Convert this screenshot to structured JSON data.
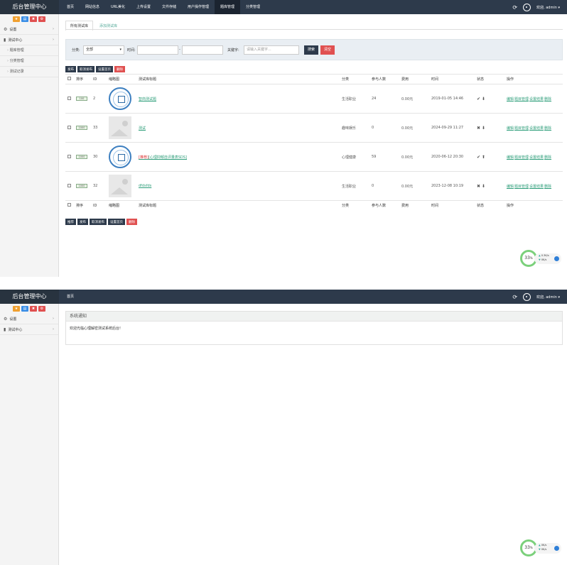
{
  "brand": "后台管理中心",
  "user": "欢迎, admin ▾",
  "top_nav": [
    "首页",
    "网站信息",
    "URL美化",
    "上传设置",
    "文件存储",
    "用户操作管理",
    "题库管理",
    "分类管理"
  ],
  "quick_buttons": [
    {
      "icon": "star-icon",
      "glyph": "★",
      "color": "#f0a030"
    },
    {
      "icon": "doc-icon",
      "glyph": "▤",
      "color": "#3a8ee6"
    },
    {
      "icon": "trash-icon",
      "glyph": "✖",
      "color": "#e05050"
    },
    {
      "icon": "gear-icon",
      "glyph": "⚙",
      "color": "#e05050"
    }
  ],
  "sidebar": {
    "settings": "设置",
    "test_center": "测试中心",
    "sub_items": [
      "题库管理",
      "分类管理",
      "测试记录"
    ]
  },
  "tabs": [
    "所有测试库",
    "添加测试库"
  ],
  "filter": {
    "category_label": "分类:",
    "category_value": "全部",
    "time_label": "时间:",
    "dash": "-",
    "keyword_label": "关键字:",
    "keyword_placeholder": "请输入关键字...",
    "search_btn": "搜索",
    "clear_btn": "清空"
  },
  "batch_top": [
    "发布",
    "取消发布",
    "设置首页",
    "删除"
  ],
  "batch_bottom": [
    "推荐",
    "发布",
    "取消发布",
    "设置首页",
    "删除"
  ],
  "columns": [
    "排序",
    "ID",
    "缩略图",
    "测试库标题",
    "分类",
    "参与人数",
    "费用",
    "时间",
    "状态",
    "操作"
  ],
  "rows": [
    {
      "order": "100",
      "id": "2",
      "thumb": "logo",
      "tag": "",
      "title": "智商测试题",
      "category": "生活职业",
      "participants": "24",
      "fee": "0.00元",
      "time": "2019-01-05 14:46",
      "status": "✔ ⬇"
    },
    {
      "order": "1000",
      "id": "33",
      "thumb": "placeholder",
      "tag": "",
      "title": "测试",
      "category": "趣味娱乐",
      "participants": "0",
      "fee": "0.00元",
      "time": "2024-09-29 11:27",
      "status": "✖ ⬇"
    },
    {
      "order": "1000",
      "id": "30",
      "thumb": "logo",
      "tag": "[推荐]",
      "title": "[心理抑郁自评量表SDS]",
      "category": "心理健康",
      "participants": "59",
      "fee": "0.00元",
      "time": "2020-06-12 20:30",
      "status": "✔ ⬆"
    },
    {
      "order": "1000",
      "id": "32",
      "thumb": "placeholder",
      "tag": "",
      "title": "dfdsfds",
      "category": "生活职业",
      "participants": "0",
      "fee": "0.00元",
      "time": "2023-12-08 10:19",
      "status": "✖ ⬇"
    }
  ],
  "ops": [
    "编辑",
    "题目管理",
    "设置结果",
    "删除"
  ],
  "gauge1": {
    "percent": "33",
    "unit": "%",
    "up": "0.3K/s",
    "down": "0K/s"
  },
  "gauge2": {
    "percent": "33",
    "unit": "%",
    "up": "0K/s",
    "down": "0K/s"
  },
  "home": {
    "nav": "首页",
    "notice_title": "系统通知",
    "notice_text": "欢迎光临心理解密测试系统后台!"
  }
}
